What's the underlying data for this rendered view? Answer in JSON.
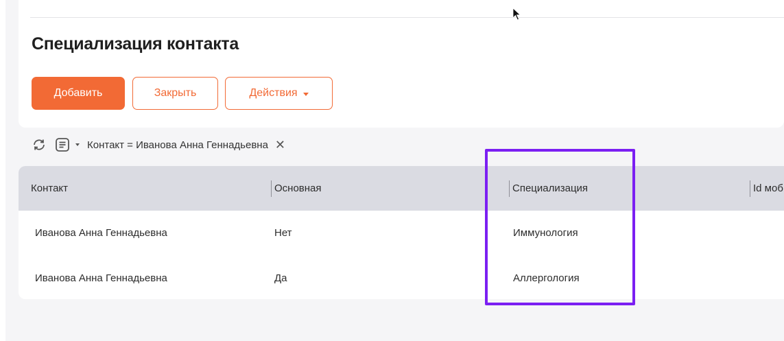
{
  "page": {
    "title": "Специализация контакта"
  },
  "toolbar": {
    "add_label": "Добавить",
    "close_label": "Закрыть",
    "actions_label": "Действия"
  },
  "filter": {
    "refresh_icon": "refresh-icon",
    "list_icon": "list-icon",
    "text": "Контакт = Иванова Анна Геннадьевна",
    "remove_symbol": "✕"
  },
  "table": {
    "columns": [
      "Контакт",
      "Основная",
      "Специализация",
      "Id моб"
    ],
    "rows": [
      [
        "Иванова Анна Геннадьевна",
        "Нет",
        "Иммунология"
      ],
      [
        "Иванова Анна Геннадьевна",
        "Да",
        "Аллергология"
      ]
    ]
  },
  "colors": {
    "accent": "#f26a35",
    "highlight": "#7b1ff2",
    "header_bg": "#dadbe2"
  }
}
